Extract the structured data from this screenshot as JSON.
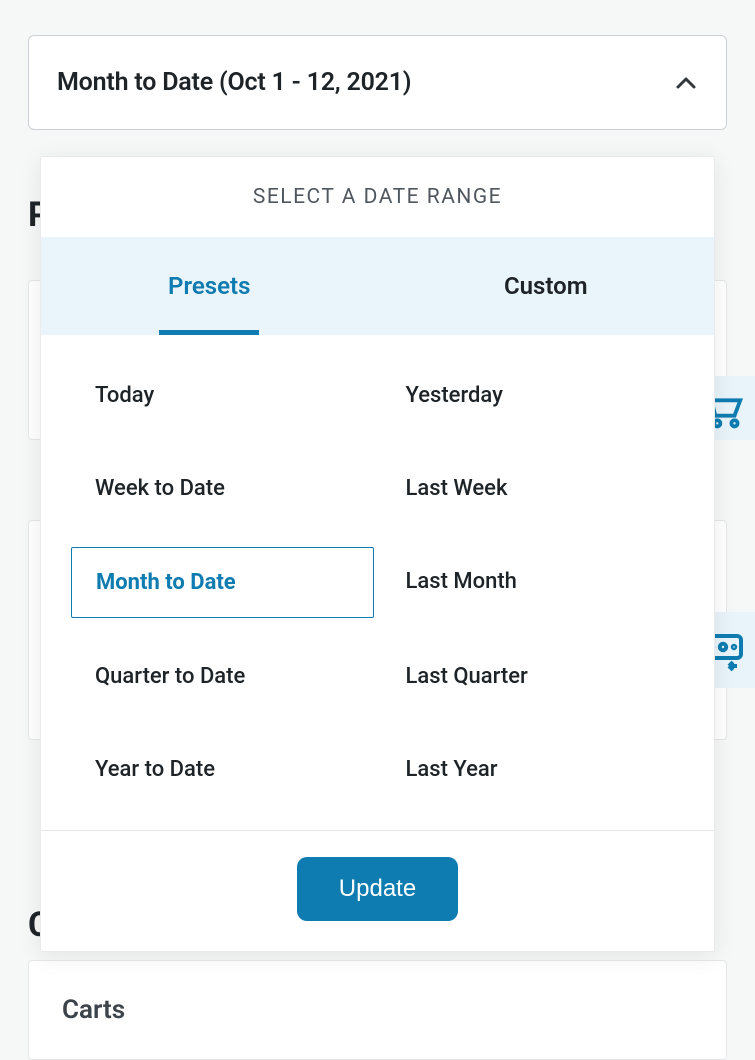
{
  "selector": {
    "label": "Month to Date (Oct 1 - 12, 2021)"
  },
  "panel": {
    "title": "SELECT A DATE RANGE",
    "tabs": {
      "presets": "Presets",
      "custom": "Custom"
    },
    "presets": {
      "today": "Today",
      "yesterday": "Yesterday",
      "week_to_date": "Week to Date",
      "last_week": "Last Week",
      "month_to_date": "Month to Date",
      "last_month": "Last Month",
      "quarter_to_date": "Quarter to Date",
      "last_quarter": "Last Quarter",
      "year_to_date": "Year to Date",
      "last_year": "Last Year"
    },
    "update_button": "Update"
  },
  "bg": {
    "carts": "Carts"
  }
}
